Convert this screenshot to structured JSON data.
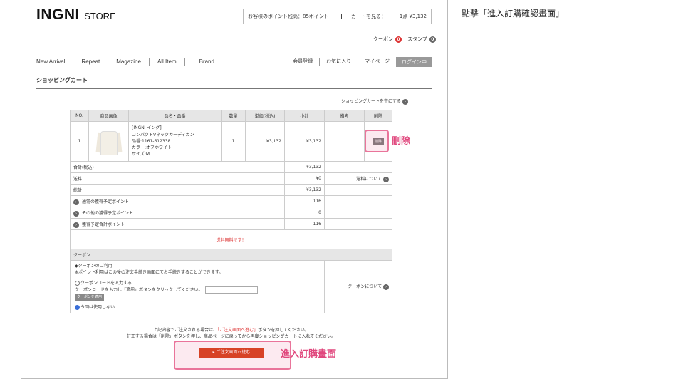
{
  "caption": "點擊「進入訂購確認畫面」",
  "header": {
    "logo_main": "INGNI",
    "logo_sub": "STORE",
    "points_text": "お客様のポイント残高：85ポイント",
    "cart_label": "カートを見る：",
    "cart_count": "1点 ¥3,132",
    "coupon_label": "クーポン",
    "coupon_count": "0",
    "stamp_label": "スタンプ",
    "stamp_count": "0"
  },
  "nav": {
    "items": [
      "New Arrival",
      "Repeat",
      "Magazine",
      "All Item",
      "Brand"
    ],
    "right": [
      "会員登録",
      "お気に入り",
      "マイページ"
    ],
    "login": "ログイン中"
  },
  "page_title": "ショッピングカート",
  "clear_cart": "ショッピングカートを空にする",
  "table": {
    "headers": [
      "NO.",
      "商品画像",
      "品名・品番",
      "数量",
      "単価(税込)",
      "小計",
      "備考",
      "削除"
    ],
    "row": {
      "no": "1",
      "name1": "[INGNI イング]",
      "name2": "コンパクトVネックカーディガン",
      "code": "品番:1161-612338",
      "color": "カラー:オフホワイト",
      "size": "サイズ:M",
      "qty": "1",
      "price": "¥3,132",
      "subtotal": "¥3,132",
      "delete": "削除"
    },
    "summary": [
      {
        "label": "合計(税込)",
        "value": "¥3,132",
        "note": ""
      },
      {
        "label": "送料",
        "value": "¥0",
        "note": "送料について"
      },
      {
        "label": "総計",
        "value": "¥3,132",
        "note": ""
      }
    ],
    "points": [
      {
        "label": "通常の獲得予定ポイント",
        "value": "116"
      },
      {
        "label": "その他の獲得予定ポイント",
        "value": "0"
      },
      {
        "label": "獲得予定合計ポイント",
        "value": "116"
      }
    ],
    "free_shipping": "送料無料です！",
    "coupon_header": "クーポン",
    "coupon_use_title": "◆クーポンのご利用",
    "coupon_use_desc": "※ポイント利用はこの後の注文手続き画面にてお手続きすることができます。",
    "coupon_enter": "クーポンコードを入力する",
    "coupon_enter_desc": "クーポンコードを入力し「適用」ボタンをクリックしてください。",
    "coupon_apply": "クーポンを適用",
    "coupon_none": "今回は使用しない",
    "coupon_about": "クーポンについて"
  },
  "note": {
    "line1_a": "上記内容でご注文される場合は、",
    "line1_red": "「ご注文画面へ進む」",
    "line1_b": "ボタンを押してください。",
    "line2": "訂正する場合は「削除」ボタンを押し、商品ページに戻ってから再度ショッピングカートに入れてください。"
  },
  "order_button": "ご注文画面へ進む",
  "annotations": {
    "delete_label": "刪除",
    "order_label": "進入訂購畫面"
  }
}
